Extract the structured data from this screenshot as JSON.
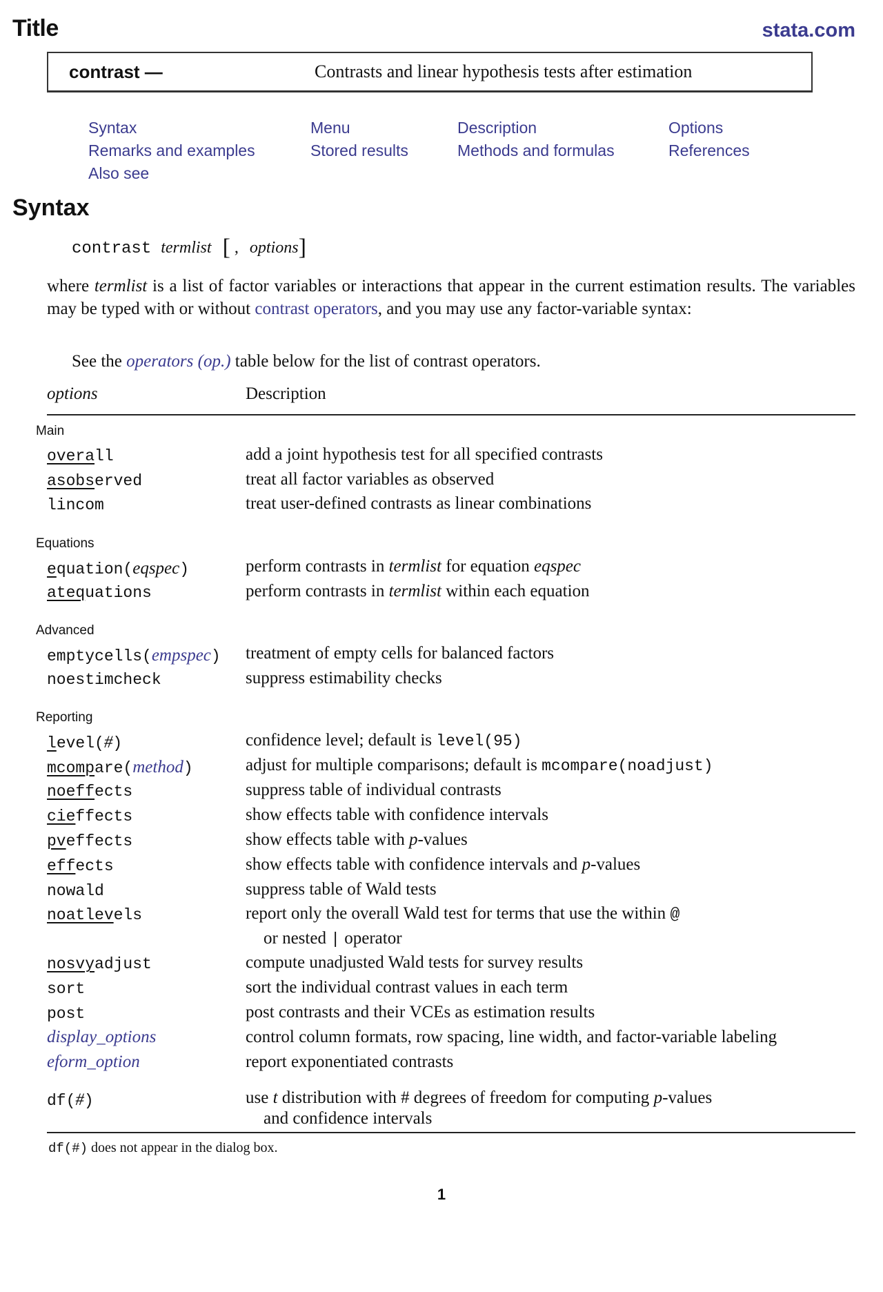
{
  "header": {
    "section_label": "Title",
    "site_link": "stata.com"
  },
  "title_box": {
    "command": "contrast",
    "dash": " — ",
    "description": "Contrasts and linear hypothesis tests after estimation"
  },
  "nav": {
    "links": [
      {
        "label": "Syntax"
      },
      {
        "label": "Menu"
      },
      {
        "label": "Description"
      },
      {
        "label": "Options"
      },
      {
        "label": "Remarks and examples"
      },
      {
        "label": "Stored results"
      },
      {
        "label": "Methods and formulas"
      },
      {
        "label": "References"
      },
      {
        "label": "Also see"
      }
    ]
  },
  "syntax": {
    "heading": "Syntax",
    "command": "contrast",
    "arg": "termlist",
    "open_bracket": "[",
    "comma": ",",
    "options": "options",
    "close_bracket": "]"
  },
  "paragraphs": {
    "p1_a": "where ",
    "p1_termlist": "termlist",
    "p1_b": " is a list of factor variables or interactions that appear in the current estimation results. The variables may be typed with or without ",
    "p1_link": "contrast operators",
    "p1_c": ", and you may use any factor-variable syntax:",
    "p2_a": "See the ",
    "p2_link": "operators (op.)",
    "p2_b": " table below for the list of contrast operators."
  },
  "table": {
    "header_options": "options",
    "header_description": "Description",
    "groups": {
      "main": "Main",
      "equations": "Equations",
      "advanced": "Advanced",
      "reporting": "Reporting"
    },
    "rows": {
      "overall": {
        "u": "overa",
        "rest": "ll",
        "desc": "add a joint hypothesis test for all specified contrasts"
      },
      "asobserved": {
        "u": "asobs",
        "rest": "erved",
        "desc": "treat all factor variables as observed"
      },
      "lincom": {
        "name": "lincom",
        "desc": "treat user-defined contrasts as linear combinations"
      },
      "equation": {
        "u": "e",
        "rest": "quation(",
        "arg": "eqspec",
        "close": ")",
        "desc_a": "perform contrasts in ",
        "desc_it": "termlist",
        "desc_b": " for equation ",
        "desc_it2": "eqspec"
      },
      "atequations": {
        "u": "ateq",
        "rest": "uations",
        "desc_a": "perform contrasts in ",
        "desc_it": "termlist",
        "desc_b": " within each equation"
      },
      "emptycells": {
        "name": "emptycells(",
        "arg": "empspec",
        "close": ")",
        "desc": "treatment of empty cells for balanced factors"
      },
      "noestimcheck": {
        "name": "noestimcheck",
        "desc": "suppress estimability checks"
      },
      "level": {
        "u": "l",
        "rest": "evel(",
        "arg": "#",
        "close": ")",
        "desc_a": "confidence level; default is ",
        "desc_m": "level(95)"
      },
      "mcompare": {
        "u": "mcomp",
        "rest": "are(",
        "arg": "method",
        "close": ")",
        "desc_a": "adjust for multiple comparisons; default is ",
        "desc_m": "mcompare(noadjust)"
      },
      "noeffects": {
        "u": "noeff",
        "rest": "ects",
        "desc": "suppress table of individual contrasts"
      },
      "cieffects": {
        "u": "cie",
        "rest": "ffects",
        "desc": "show effects table with confidence intervals"
      },
      "pveffects": {
        "u": "pv",
        "rest": "effects",
        "desc_a": "show effects table with ",
        "desc_it": "p",
        "desc_b": "-values"
      },
      "effects": {
        "u": "eff",
        "rest": "ects",
        "desc_a": "show effects table with confidence intervals and ",
        "desc_it": "p",
        "desc_b": "-values"
      },
      "nowald": {
        "name": "nowald",
        "desc": "suppress table of Wald tests"
      },
      "noatlevels": {
        "u": "noatlev",
        "rest": "els",
        "desc_a": "report only the overall Wald test for terms that use the within ",
        "desc_m": "@",
        "desc_cont_a": "or nested ",
        "desc_cont_m": "|",
        "desc_cont_b": " operator"
      },
      "nosvyadjust": {
        "u": "nosvy",
        "rest": "adjust",
        "desc": "compute unadjusted Wald tests for survey results"
      },
      "sort": {
        "name": "sort",
        "desc": "sort the individual contrast values in each term"
      },
      "post": {
        "name": "post",
        "desc_a": "post contrasts and their ",
        "desc_sc": "VCE",
        "desc_b": "s as estimation results"
      },
      "display_options": {
        "name": "display_options",
        "desc": "control column formats, row spacing, line width, and factor-variable labeling"
      },
      "eform_option": {
        "name": "eform_option",
        "desc": "report exponentiated contrasts"
      },
      "df": {
        "name": "df(",
        "arg": "#",
        "close": ")",
        "desc_a": "use ",
        "desc_it": "t",
        "desc_b": " distribution with # degrees of freedom for computing ",
        "desc_it2": "p",
        "desc_c": "-values",
        "desc_cont": "and confidence intervals"
      }
    }
  },
  "footnote": {
    "code": "df(#)",
    "text": " does not appear in the dialog box."
  },
  "page_number": "1"
}
